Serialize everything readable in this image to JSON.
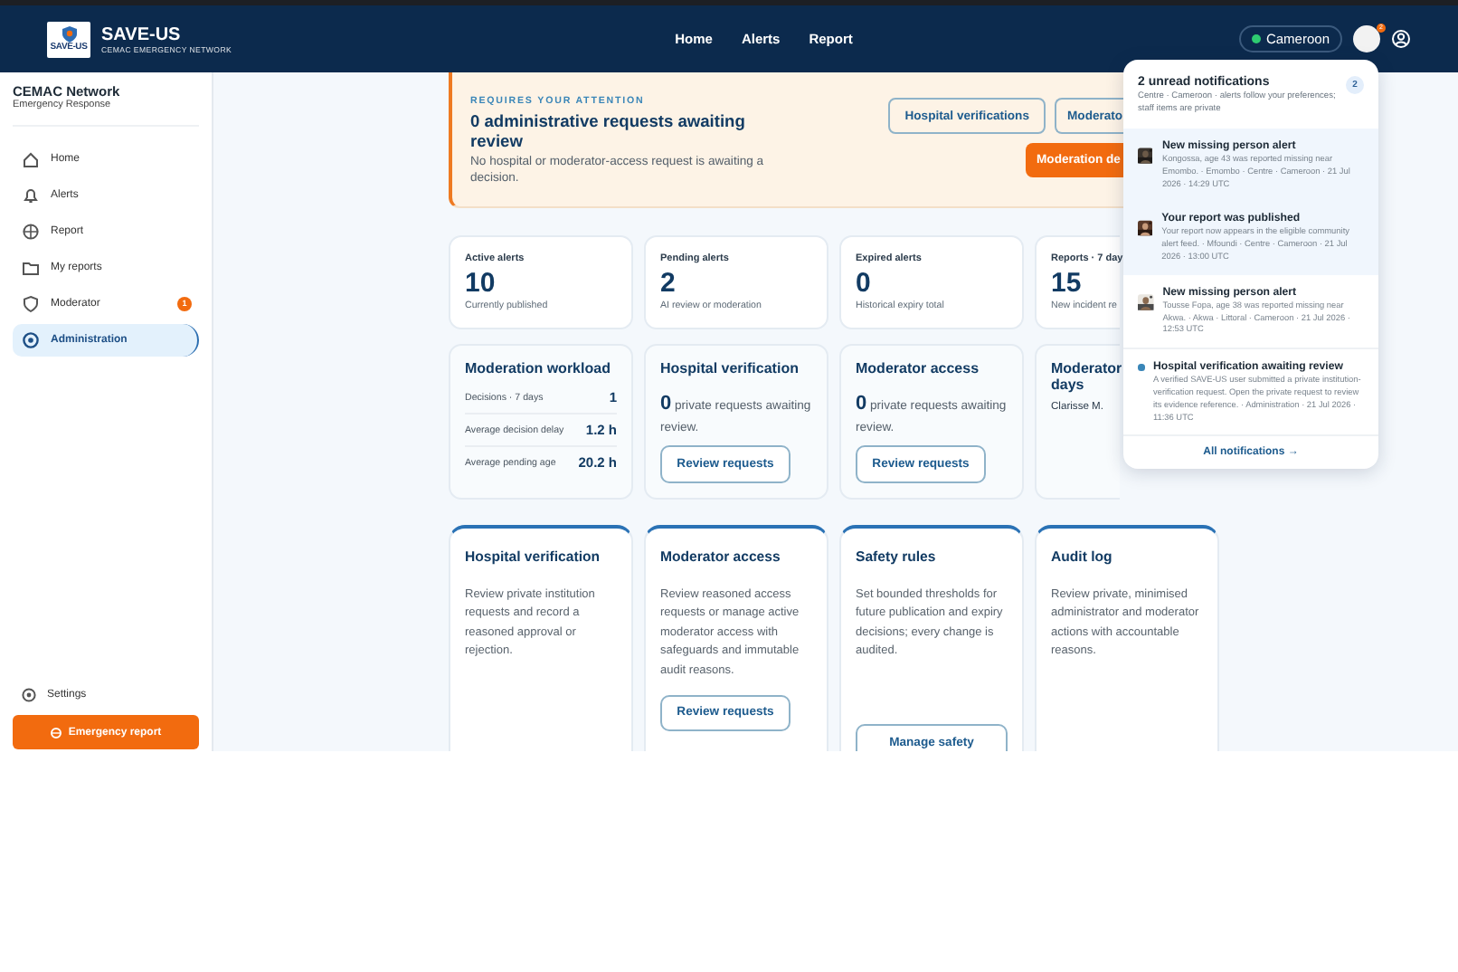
{
  "header": {
    "brand": "SAVE-US",
    "tagline": "CEMAC EMERGENCY NETWORK",
    "logo_text": "SAVE-US",
    "nav": [
      {
        "label": "Home"
      },
      {
        "label": "Alerts"
      },
      {
        "label": "Report"
      }
    ],
    "region": "Cameroon",
    "notification_count": "2"
  },
  "sidebar": {
    "title": "CEMAC Network",
    "subtitle": "Emergency Response",
    "items": [
      {
        "label": "Home",
        "selected": false
      },
      {
        "label": "Alerts",
        "selected": false
      },
      {
        "label": "Report",
        "selected": false
      },
      {
        "label": "My reports",
        "selected": false
      },
      {
        "label": "Moderator",
        "selected": false,
        "badge": "1"
      },
      {
        "label": "Administration",
        "selected": true
      }
    ],
    "settings": "Settings",
    "emergency_button": "Emergency report"
  },
  "attention": {
    "eyebrow": "REQUIRES YOUR ATTENTION",
    "title": "0 administrative requests awaiting review",
    "text": "No hospital or moderator-access request is awaiting a decision.",
    "buttons": [
      {
        "label": "Hospital verifications",
        "kind": "outline"
      },
      {
        "label": "Moderato",
        "kind": "outline"
      },
      {
        "label": "Moderation de",
        "kind": "primary"
      }
    ]
  },
  "stats": [
    {
      "label": "Active alerts",
      "value": "10",
      "note": "Currently published"
    },
    {
      "label": "Pending alerts",
      "value": "2",
      "note": "AI review or moderation"
    },
    {
      "label": "Expired alerts",
      "value": "0",
      "note": "Historical expiry total"
    },
    {
      "label": "Reports · 7 day",
      "value": "15",
      "note": "New incident re"
    }
  ],
  "panels": [
    {
      "kind": "metrics",
      "title": "Moderation workload",
      "rows": [
        {
          "label": "Decisions · 7 days",
          "value": "1"
        },
        {
          "label": "Average decision delay",
          "value": "1.2 h"
        },
        {
          "label": "Average pending age",
          "value": "20.2 h"
        }
      ]
    },
    {
      "kind": "queue",
      "title": "Hospital verification",
      "text": "**0** private requests awaiting review.",
      "button": "Review requests"
    },
    {
      "kind": "queue",
      "title": "Moderator access",
      "text": "**0** private requests awaiting review.",
      "button": "Review requests"
    },
    {
      "kind": "people",
      "title": "Moderator days",
      "text": "Clarisse M."
    }
  ],
  "tools": [
    {
      "title": "Hospital verification",
      "text": "Review private institution requests and record a reasoned approval or rejection."
    },
    {
      "title": "Moderator access",
      "text": "Review reasoned access requests or manage active moderator access with safeguards and immutable audit reasons.",
      "button": "Review requests"
    },
    {
      "title": "Safety rules",
      "text": "Set bounded thresholds for future publication and expiry decisions; every change is audited.",
      "button": "Manage safety"
    },
    {
      "title": "Audit log",
      "text": "Review private, minimised administrator and moderator actions with accountable reasons."
    }
  ],
  "notifications": {
    "title": "2 unread notifications",
    "count": "2",
    "subtitle": "Centre · Cameroon · alerts follow your preferences; staff items are private",
    "items": [
      {
        "kind": "avatar",
        "unread": true,
        "title": "New missing person alert",
        "text": "Kongossa, age 43 was reported missing near Emombo. · Emombo · Centre · Cameroon · 21 Jul 2026 · 14:29 UTC"
      },
      {
        "kind": "avatar",
        "unread": true,
        "title": "Your report was published",
        "text": "Your report now appears in the eligible community alert feed. · Mfoundi · Centre · Cameroon · 21 Jul 2026 · 13:00 UTC"
      },
      {
        "kind": "avatar",
        "unread": false,
        "title": "New missing person alert",
        "text": "Tousse Fopa, age 38 was reported missing near Akwa. · Akwa · Littoral · Cameroon · 21 Jul 2026 · 12:53 UTC"
      },
      {
        "kind": "dot",
        "unread": false,
        "title": "Hospital verification awaiting review",
        "text": "A verified SAVE-US user submitted a private institution-verification request. Open the private request to review its evidence reference. · Administration · 21 Jul 2026 · 11:36 UTC"
      }
    ],
    "footer": "All notifications →"
  }
}
